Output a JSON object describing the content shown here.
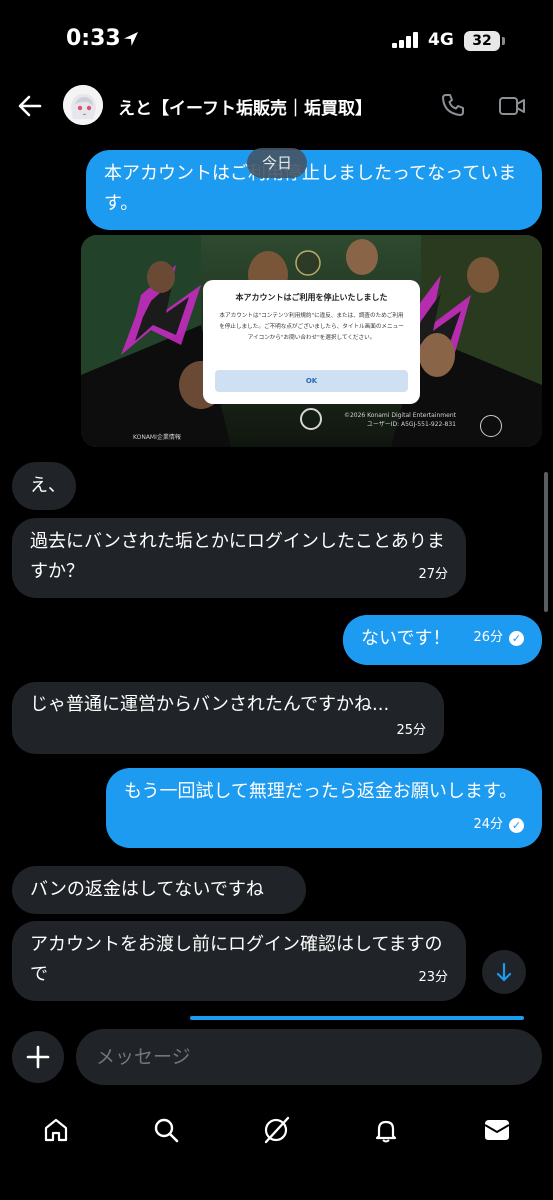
{
  "status_bar": {
    "time": "0:33",
    "network": "4G",
    "battery": "32"
  },
  "header": {
    "title": "えと【イーフト垢販売｜垢買取】"
  },
  "date_divider": "今日",
  "messages": [
    {
      "direction": "out",
      "text": "本アカウントはご利用停止しましたってなっています。"
    },
    {
      "direction": "in",
      "text": "え、"
    },
    {
      "direction": "in",
      "text": "過去にバンされた垢とかにログインしたことありますか？",
      "time": "27分"
    },
    {
      "direction": "out",
      "text": "ないです！",
      "time": "26分",
      "read": true
    },
    {
      "direction": "in",
      "text": "じゃ普通に運営からバンされたんですかね...",
      "time": "25分"
    },
    {
      "direction": "out",
      "text": "もう一回試して無理だったら返金お願いします。",
      "time": "24分",
      "read": true
    },
    {
      "direction": "in",
      "text": "バンの返金はしてないですね"
    },
    {
      "direction": "in",
      "text": "アカウントをお渡し前にログイン確認はしてますので",
      "time": "23分"
    }
  ],
  "attachment": {
    "dialog_title": "本アカウントはご利用を停止いたしました",
    "dialog_body": "本アカウントは\"コンテンツ利用規約\"に違反、または、調査のためご利用を停止しました。ご不明な点がございましたら、タイトル画面のメニューアイコンから\"お問い合わせ\"を選択してください。",
    "ok_label": "OK",
    "copyright": "©2026 Konami Digital Entertainment",
    "user_id": "ユーザーID: A5GJ-551-922-831",
    "publisher_label": "KONAMI企業情報"
  },
  "composer": {
    "placeholder": "メッセージ"
  },
  "colors": {
    "accent": "#1d9bf0",
    "bubble_in": "#202327",
    "background": "#000000"
  },
  "tabs": [
    "home-icon",
    "search-icon",
    "grok-icon",
    "notifications-icon",
    "messages-icon"
  ]
}
